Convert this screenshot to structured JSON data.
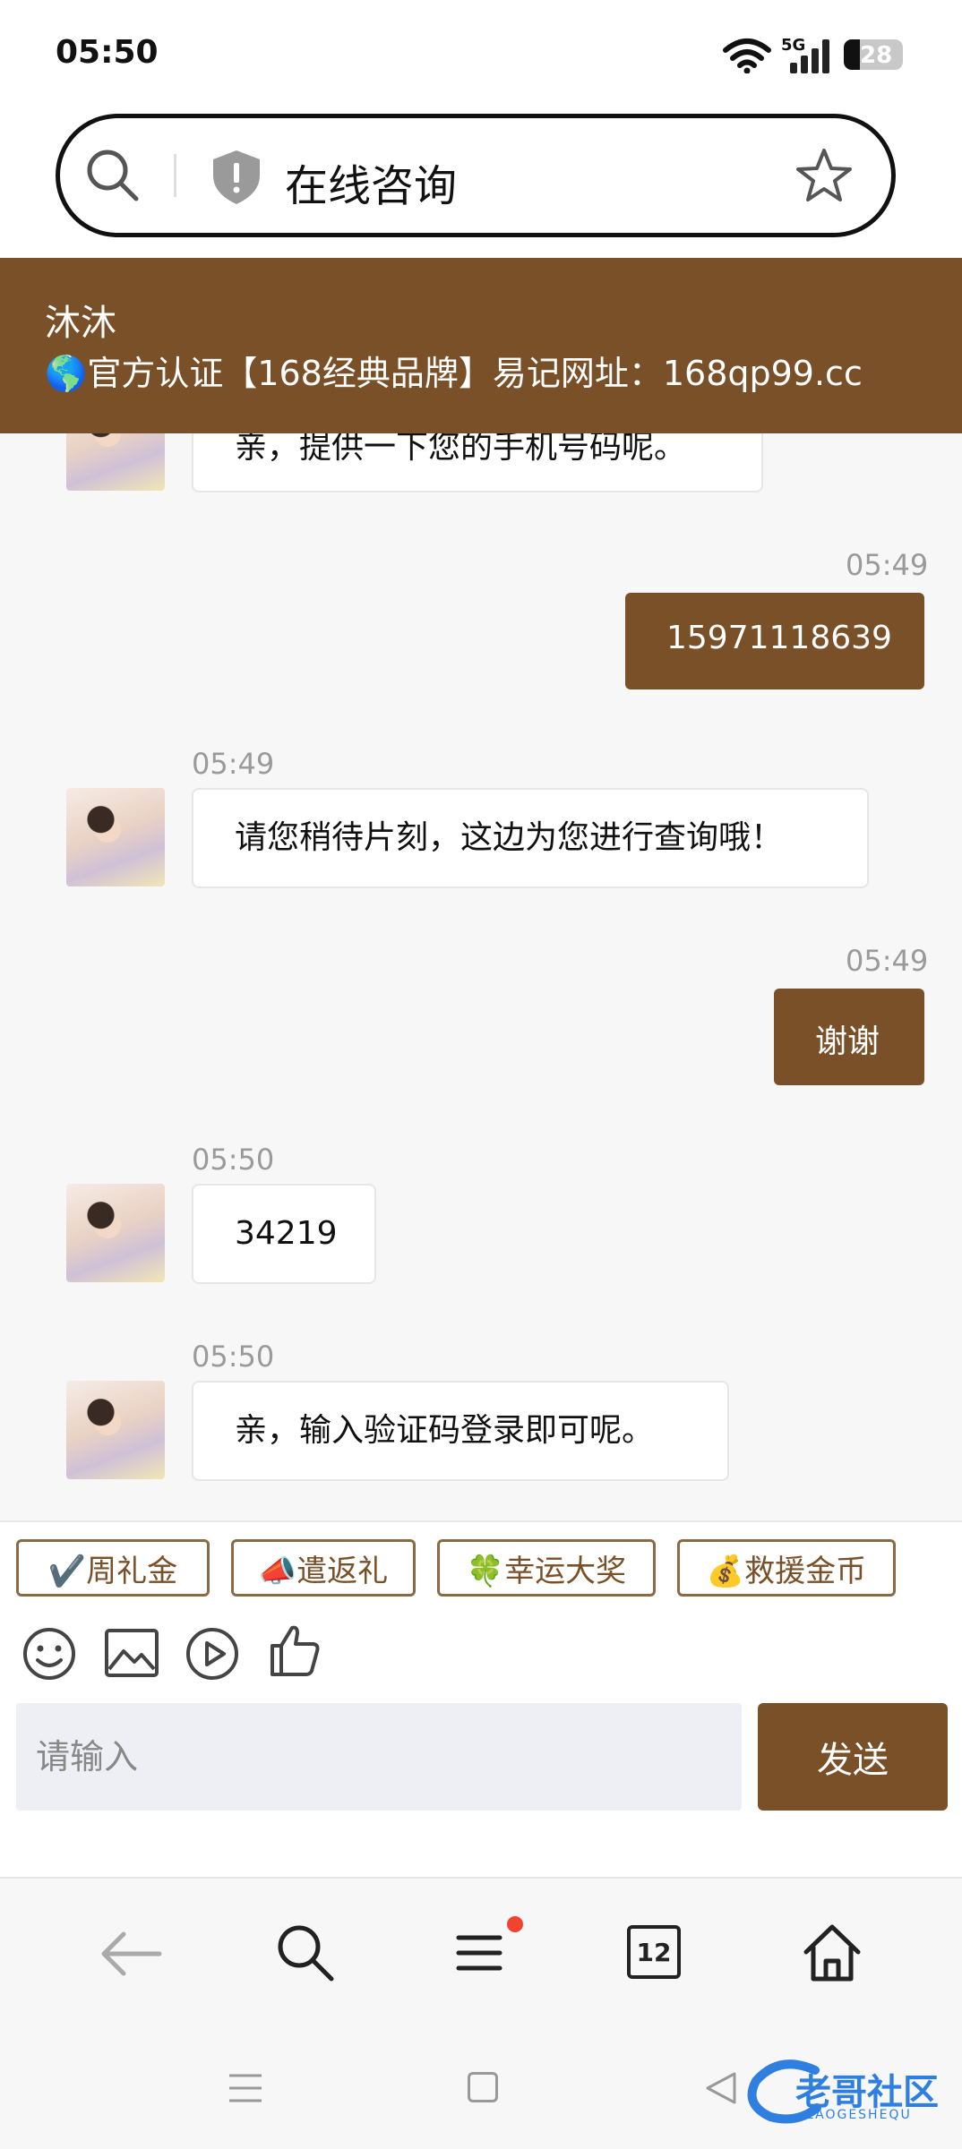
{
  "status_bar": {
    "time": "05:50",
    "network": "5G",
    "battery": "28",
    "battery_level": 0.28
  },
  "url_bar": {
    "title": "在线咨询"
  },
  "chat_header": {
    "agent_name": "沐沐",
    "notice": "🌎官方认证【168经典品牌】易记网址：168qp99.cc"
  },
  "messages": [
    {
      "from": "agent",
      "time": "",
      "text": "亲，提供一下您的手机号码呢。"
    },
    {
      "from": "user",
      "time": "05:49",
      "text": "15971118639"
    },
    {
      "from": "agent",
      "time": "05:49",
      "text": "请您稍待片刻，这边为您进行查询哦！"
    },
    {
      "from": "user",
      "time": "05:49",
      "text": "谢谢"
    },
    {
      "from": "agent",
      "time": "05:50",
      "text": "34219"
    },
    {
      "from": "agent",
      "time": "05:50",
      "text": "亲，输入验证码登录即可呢。"
    }
  ],
  "quick_replies": [
    "✔️周礼金",
    "📣遣返礼",
    "🍀幸运大奖",
    "💰救援金币"
  ],
  "composer": {
    "placeholder": "请输入",
    "send_label": "发送"
  },
  "browser_nav": {
    "tab_count": "12",
    "menu_badge_color": "#f0442e"
  },
  "watermark": {
    "text": "老哥社区",
    "subtext": "LAOGESHEQU"
  },
  "colors": {
    "accent": "#7a5028",
    "chip_border": "#8a6a45"
  }
}
